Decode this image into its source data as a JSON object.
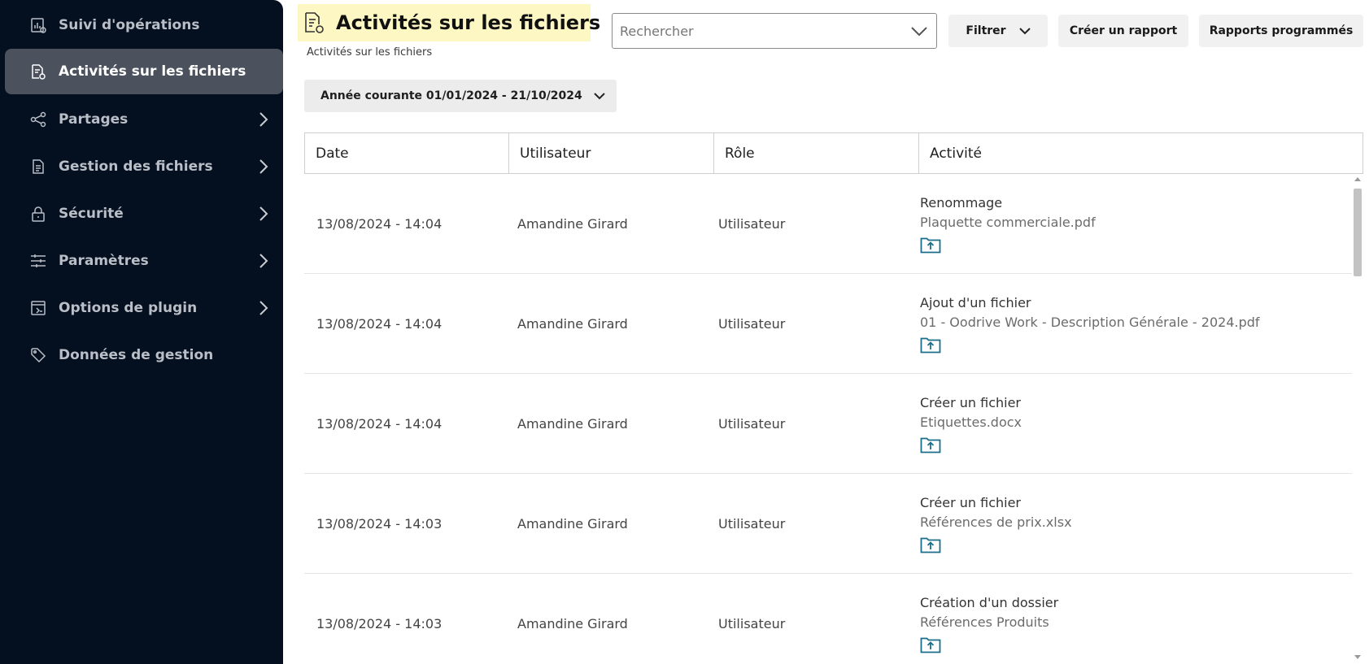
{
  "colors": {
    "sidebar_bg": "#040f1f",
    "sidebar_active_bg": "#4b525d",
    "title_highlight": "#fdf7c3",
    "accent_icon": "#1a6e8a"
  },
  "sidebar": {
    "items": [
      {
        "label": "Suivi d'opérations",
        "icon": "chart-report-icon",
        "has_submenu": false,
        "active": false
      },
      {
        "label": "Activités sur les fichiers",
        "icon": "file-activity-icon",
        "has_submenu": false,
        "active": true
      },
      {
        "label": "Partages",
        "icon": "share-icon",
        "has_submenu": true,
        "active": false
      },
      {
        "label": "Gestion des fichiers",
        "icon": "file-icon",
        "has_submenu": true,
        "active": false
      },
      {
        "label": "Sécurité",
        "icon": "lock-icon",
        "has_submenu": true,
        "active": false
      },
      {
        "label": "Paramètres",
        "icon": "sliders-icon",
        "has_submenu": true,
        "active": false
      },
      {
        "label": "Options de plugin",
        "icon": "plugin-window-icon",
        "has_submenu": true,
        "active": false
      },
      {
        "label": "Données de gestion",
        "icon": "tag-icon",
        "has_submenu": false,
        "active": false
      }
    ]
  },
  "header": {
    "title": "Activités sur les fichiers",
    "subtitle": "Activités sur les fichiers",
    "search_placeholder": "Rechercher",
    "filter_label": "Filtrer",
    "create_report_label": "Créer un rapport",
    "scheduled_reports_label": "Rapports programmés",
    "period_label": "Année courante 01/01/2024 - 21/10/2024"
  },
  "table": {
    "columns": [
      "Date",
      "Utilisateur",
      "Rôle",
      "Activité"
    ],
    "rows": [
      {
        "date": "13/08/2024 - 14:04",
        "user": "Amandine Girard",
        "role": "Utilisateur",
        "activity": "Renommage",
        "file": "Plaquette commerciale.pdf"
      },
      {
        "date": "13/08/2024 - 14:04",
        "user": "Amandine Girard",
        "role": "Utilisateur",
        "activity": "Ajout d'un fichier",
        "file": "01 - Oodrive Work - Description Générale - 2024.pdf"
      },
      {
        "date": "13/08/2024 - 14:04",
        "user": "Amandine Girard",
        "role": "Utilisateur",
        "activity": "Créer un fichier",
        "file": "Etiquettes.docx"
      },
      {
        "date": "13/08/2024 - 14:03",
        "user": "Amandine Girard",
        "role": "Utilisateur",
        "activity": "Créer un fichier",
        "file": "Références de prix.xlsx"
      },
      {
        "date": "13/08/2024 - 14:03",
        "user": "Amandine Girard",
        "role": "Utilisateur",
        "activity": "Création d'un dossier",
        "file": "Références Produits"
      }
    ]
  }
}
